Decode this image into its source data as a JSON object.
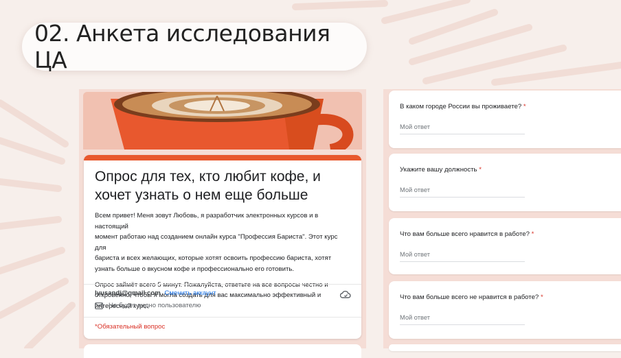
{
  "slide": {
    "title": "02. Анкета исследования ЦА"
  },
  "form": {
    "title": "Опрос для тех, кто любит кофе, и хочет узнать о нем еще больше",
    "description_p1": "Всем привет! Меня зовут Любовь, я разработчик электронных курсов и в настоящий\nмомент работаю над созданием онлайн курса \"Профессия Бариста\". Этот курс для\nбариста и всех желающих, которые хотят освоить профессию бариста, хотят\nузнать больше о вкусном кофе и профессионально его готовить.",
    "description_p2": "Опрос займёт всего 5 минут. Пожалуйста, ответьте на все вопросы честно и\nоткровенно, чтобы я могла создать для вас максимально эффективный и\nинтересный курс.",
    "account_email": "lyusandj@gmail.com",
    "switch_account": "Сменить аккаунт",
    "not_shown": "Не будет видно пользователю",
    "required_note": "*Обязательный вопрос"
  },
  "questions": [
    {
      "text": "В каком городе России вы проживаете?",
      "required": "*",
      "answer_placeholder": "Мой ответ"
    },
    {
      "text": "Укажите вашу должность",
      "required": "*",
      "answer_placeholder": "Мой ответ"
    },
    {
      "text": "Что вам больше всего нравится в работе?",
      "required": "*",
      "answer_placeholder": "Мой ответ"
    },
    {
      "text": "Что вам больше всего не нравится в работе?",
      "required": "*",
      "answer_placeholder": "Мой ответ"
    }
  ],
  "colors": {
    "accent": "#e8582e",
    "required": "#d93025",
    "link": "#1a73e8",
    "panel": "#f5ddd6"
  },
  "icons": {
    "cloud": "cloud-off-icon",
    "mail": "mail-icon"
  }
}
